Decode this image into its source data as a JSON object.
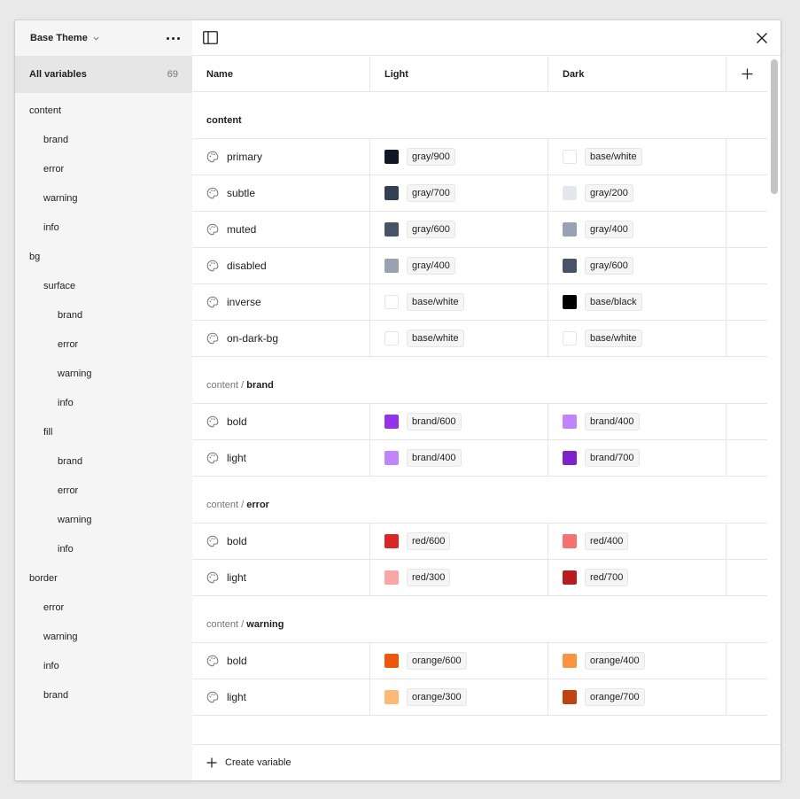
{
  "sidebar": {
    "title": "Base Theme",
    "all_label": "All variables",
    "all_count": "69",
    "tree": [
      {
        "label": "content",
        "level": 0
      },
      {
        "label": "brand",
        "level": 1
      },
      {
        "label": "error",
        "level": 1
      },
      {
        "label": "warning",
        "level": 1
      },
      {
        "label": "info",
        "level": 1
      },
      {
        "label": "bg",
        "level": 0
      },
      {
        "label": "surface",
        "level": 1
      },
      {
        "label": "brand",
        "level": 2
      },
      {
        "label": "error",
        "level": 2
      },
      {
        "label": "warning",
        "level": 2
      },
      {
        "label": "info",
        "level": 2
      },
      {
        "label": "fill",
        "level": 1
      },
      {
        "label": "brand",
        "level": 2
      },
      {
        "label": "error",
        "level": 2
      },
      {
        "label": "warning",
        "level": 2
      },
      {
        "label": "info",
        "level": 2
      },
      {
        "label": "border",
        "level": 0
      },
      {
        "label": "error",
        "level": 1
      },
      {
        "label": "warning",
        "level": 1
      },
      {
        "label": "info",
        "level": 1
      },
      {
        "label": "brand",
        "level": 1
      }
    ]
  },
  "table": {
    "columns": {
      "name": "Name",
      "light": "Light",
      "dark": "Dark"
    },
    "groups": [
      {
        "path": "",
        "leaf": "content",
        "rows": [
          {
            "name": "primary",
            "light": {
              "label": "gray/900",
              "color": "#101828"
            },
            "dark": {
              "label": "base/white",
              "color": "#ffffff"
            }
          },
          {
            "name": "subtle",
            "light": {
              "label": "gray/700",
              "color": "#344054"
            },
            "dark": {
              "label": "gray/200",
              "color": "#e4e7ec"
            }
          },
          {
            "name": "muted",
            "light": {
              "label": "gray/600",
              "color": "#475467"
            },
            "dark": {
              "label": "gray/400",
              "color": "#98a2b3"
            }
          },
          {
            "name": "disabled",
            "light": {
              "label": "gray/400",
              "color": "#98a2b3"
            },
            "dark": {
              "label": "gray/600",
              "color": "#475467"
            }
          },
          {
            "name": "inverse",
            "light": {
              "label": "base/white",
              "color": "#ffffff"
            },
            "dark": {
              "label": "base/black",
              "color": "#000000"
            }
          },
          {
            "name": "on-dark-bg",
            "light": {
              "label": "base/white",
              "color": "#ffffff"
            },
            "dark": {
              "label": "base/white",
              "color": "#ffffff"
            }
          }
        ]
      },
      {
        "path": "content / ",
        "leaf": "brand",
        "rows": [
          {
            "name": "bold",
            "light": {
              "label": "brand/600",
              "color": "#9333ea"
            },
            "dark": {
              "label": "brand/400",
              "color": "#c084fc"
            }
          },
          {
            "name": "light",
            "light": {
              "label": "brand/400",
              "color": "#c084fc"
            },
            "dark": {
              "label": "brand/700",
              "color": "#7e22ce"
            }
          }
        ]
      },
      {
        "path": "content / ",
        "leaf": "error",
        "rows": [
          {
            "name": "bold",
            "light": {
              "label": "red/600",
              "color": "#dc2626"
            },
            "dark": {
              "label": "red/400",
              "color": "#f87171"
            }
          },
          {
            "name": "light",
            "light": {
              "label": "red/300",
              "color": "#fca5a5"
            },
            "dark": {
              "label": "red/700",
              "color": "#b91c1c"
            }
          }
        ]
      },
      {
        "path": "content / ",
        "leaf": "warning",
        "rows": [
          {
            "name": "bold",
            "light": {
              "label": "orange/600",
              "color": "#ea580c"
            },
            "dark": {
              "label": "orange/400",
              "color": "#fb923c"
            }
          },
          {
            "name": "light",
            "light": {
              "label": "orange/300",
              "color": "#fdba74"
            },
            "dark": {
              "label": "orange/700",
              "color": "#c2410c"
            }
          }
        ]
      }
    ]
  },
  "footer": {
    "create_label": "Create variable"
  },
  "icons": {
    "title_chevron": "chevron-down-icon",
    "more": "more-dots-icon",
    "sidebar_toggle": "sidebar-toggle-icon",
    "close": "close-icon",
    "add_column": "plus-icon",
    "variable_type": "palette-icon",
    "create": "plus-icon"
  },
  "colors": {
    "sidebar_bg": "#f5f5f5",
    "selected_bg": "#e6e6e6",
    "border": "#e6e6e6",
    "muted_text": "#757575"
  }
}
